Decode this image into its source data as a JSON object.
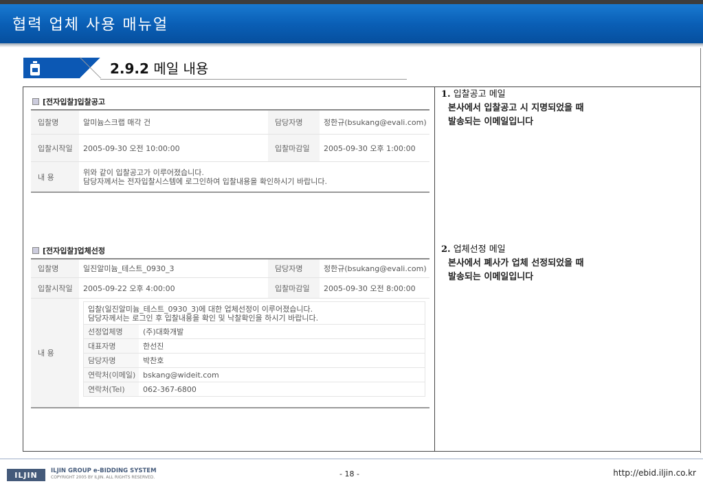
{
  "header": {
    "title": "협력 업체 사용 매뉴얼"
  },
  "section": {
    "number": "2.9.2",
    "title": "메일 내용"
  },
  "email1": {
    "heading": "[전자입찰]입찰공고",
    "rows": [
      {
        "k1": "입찰명",
        "v1": "알미늄스크랩 매각 건",
        "k2": "담당자명",
        "v2": "정한규(bsukang@evali.com)"
      },
      {
        "k1": "입찰시작일",
        "v1": "2005-09-30 오전 10:00:00",
        "k2": "입찰마감일",
        "v2": "2005-09-30 오후 1:00:00"
      }
    ],
    "content_label": "내 용",
    "content_line1": "위와 같이 입찰공고가 이루어졌습니다.",
    "content_line2": "담당자께서는 전자입찰시스템에 로그인하여 입찰내용을 확인하시기 바랍니다."
  },
  "email2": {
    "heading": "[전자입찰]업체선정",
    "rows": [
      {
        "k1": "입찰명",
        "v1": "일진알미늄_테스트_0930_3",
        "k2": "담당자명",
        "v2": "정한규(bsukang@evali.com)"
      },
      {
        "k1": "입찰시작일",
        "v1": "2005-09-22 오후 4:00:00",
        "k2": "입찰마감일",
        "v2": "2005-09-30 오전 8:00:00"
      }
    ],
    "content_label": "내 용",
    "content_line1": "입찰(일진알미늄_테스트_0930_3)에 대한 업체선정이 이루어졌습니다.",
    "content_line2": "담당자께서는 로그인 후 입찰내용을 확인 및 낙찰확인을 하시기 바랍니다.",
    "details": [
      {
        "k": "선정업체명",
        "v": "(주)대화개발"
      },
      {
        "k": "대표자명",
        "v": "한선진"
      },
      {
        "k": "담당자명",
        "v": "박찬호"
      },
      {
        "k": "연락처(이메일)",
        "v": "bskang@wideit.com"
      },
      {
        "k": "연락처(Tel)",
        "v": "062-367-6800"
      }
    ]
  },
  "desc1": {
    "num": "1.",
    "title": "입찰공고 메일",
    "line1": "본사에서 입찰공고 시 지명되었을 때",
    "line2": "발송되는 이메일입니다"
  },
  "desc2": {
    "num": "2.",
    "title": "업체선정 메일",
    "line1": "본사에서 폐사가 업체 선정되었을 때",
    "line2": "발송되는 이메일입니다"
  },
  "footer": {
    "logo": "ILJIN",
    "brand": "ILJIN GROUP e-BIDDING SYSTEM",
    "copyright": "COPYRIGHT 2005 BY ILJIN. ALL RIGHTS RESERVED.",
    "page": "- 18 -",
    "url": "http://ebid.iljin.co.kr"
  },
  "colors": {
    "header_blue": "#0a5fb6",
    "section_blue": "#0c58b4"
  }
}
